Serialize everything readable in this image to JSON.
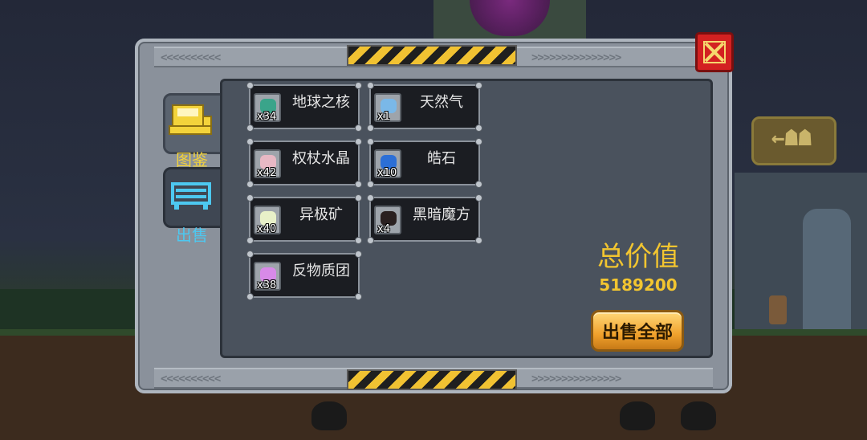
{
  "background": {
    "sign_text": "←☗☗"
  },
  "tabs": [
    {
      "label": "图鉴",
      "icon": "book-icon",
      "active": false,
      "color": "#f3d33b"
    },
    {
      "label": "出售",
      "icon": "sell-counter-icon",
      "active": true,
      "color": "#4dc8f0"
    }
  ],
  "items": [
    {
      "name": "地球之核",
      "count": "x34",
      "icon": "earth-core-icon",
      "color": "#3aa48a"
    },
    {
      "name": "天然气",
      "count": "x1",
      "icon": "natural-gas-icon",
      "color": "#7ab8e8"
    },
    {
      "name": "权杖水晶",
      "count": "x42",
      "icon": "scepter-crystal-icon",
      "color": "#e8b8c4"
    },
    {
      "name": "皓石",
      "count": "x10",
      "icon": "zircon-icon",
      "color": "#2c6fd6"
    },
    {
      "name": "异极矿",
      "count": "x40",
      "icon": "hemimorphite-icon",
      "color": "#e8f0c8"
    },
    {
      "name": "黑暗魔方",
      "count": "x4",
      "icon": "dark-cube-icon",
      "color": "#2a2020"
    },
    {
      "name": "反物质团",
      "count": "x38",
      "icon": "antimatter-icon",
      "color": "#d88ae8"
    }
  ],
  "summary": {
    "total_label": "总价值",
    "total_value": "5189200",
    "sell_all_label": "出售全部"
  },
  "colors": {
    "accent_gold": "#f2c530",
    "close_red": "#d32121",
    "sell_button": "#f0a12c"
  }
}
